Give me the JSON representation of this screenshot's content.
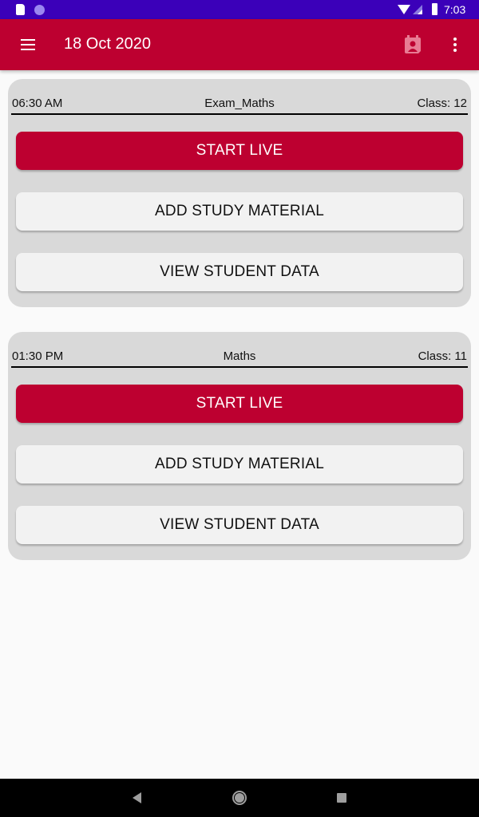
{
  "status_bar": {
    "time": "7:03",
    "icons": [
      "sd-card-icon",
      "notification-dot-icon",
      "wifi-icon",
      "signal-icon",
      "battery-icon"
    ]
  },
  "app_bar": {
    "title": "18 Oct 2020",
    "left_icon": "menu-icon",
    "right_icons": [
      "calendar-person-icon",
      "more-vert-icon"
    ]
  },
  "colors": {
    "primary": "#bd0030",
    "status_bar": "#3b00b9",
    "card_bg": "#d9d9d9",
    "secondary_button": "#f2f2f2"
  },
  "sessions": [
    {
      "time": "06:30 AM",
      "subject": "Exam_Maths",
      "class_label": "Class: 12",
      "buttons": {
        "start_live": "START LIVE",
        "add_material": "ADD STUDY MATERIAL",
        "view_students": "VIEW STUDENT DATA"
      }
    },
    {
      "time": "01:30 PM",
      "subject": "Maths",
      "class_label": "Class: 11",
      "buttons": {
        "start_live": "START LIVE",
        "add_material": "ADD STUDY MATERIAL",
        "view_students": "VIEW STUDENT DATA"
      }
    }
  ],
  "nav_bar": {
    "buttons": [
      "back",
      "home",
      "recents"
    ]
  }
}
